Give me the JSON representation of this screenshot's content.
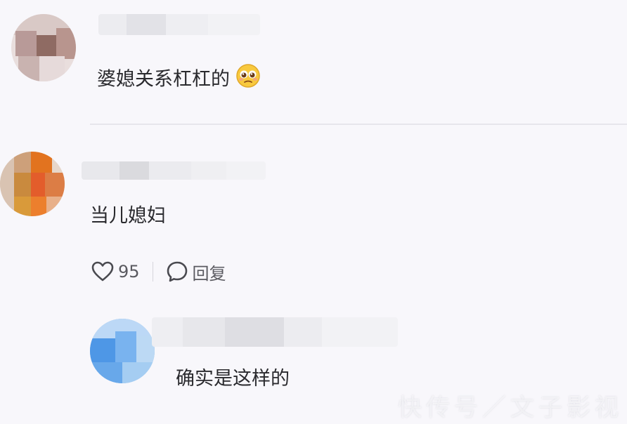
{
  "comments": [
    {
      "text": "婆媳关系杠杠的",
      "emoji": "pleading-face-emoji"
    },
    {
      "text": "当儿媳妇",
      "likes": "95",
      "reply_label": "回复"
    },
    {
      "text": "确实是这样的"
    }
  ],
  "watermark": "快传号／文子影视",
  "icons": {
    "like": "heart-outline-icon",
    "reply": "speech-bubble-icon"
  }
}
